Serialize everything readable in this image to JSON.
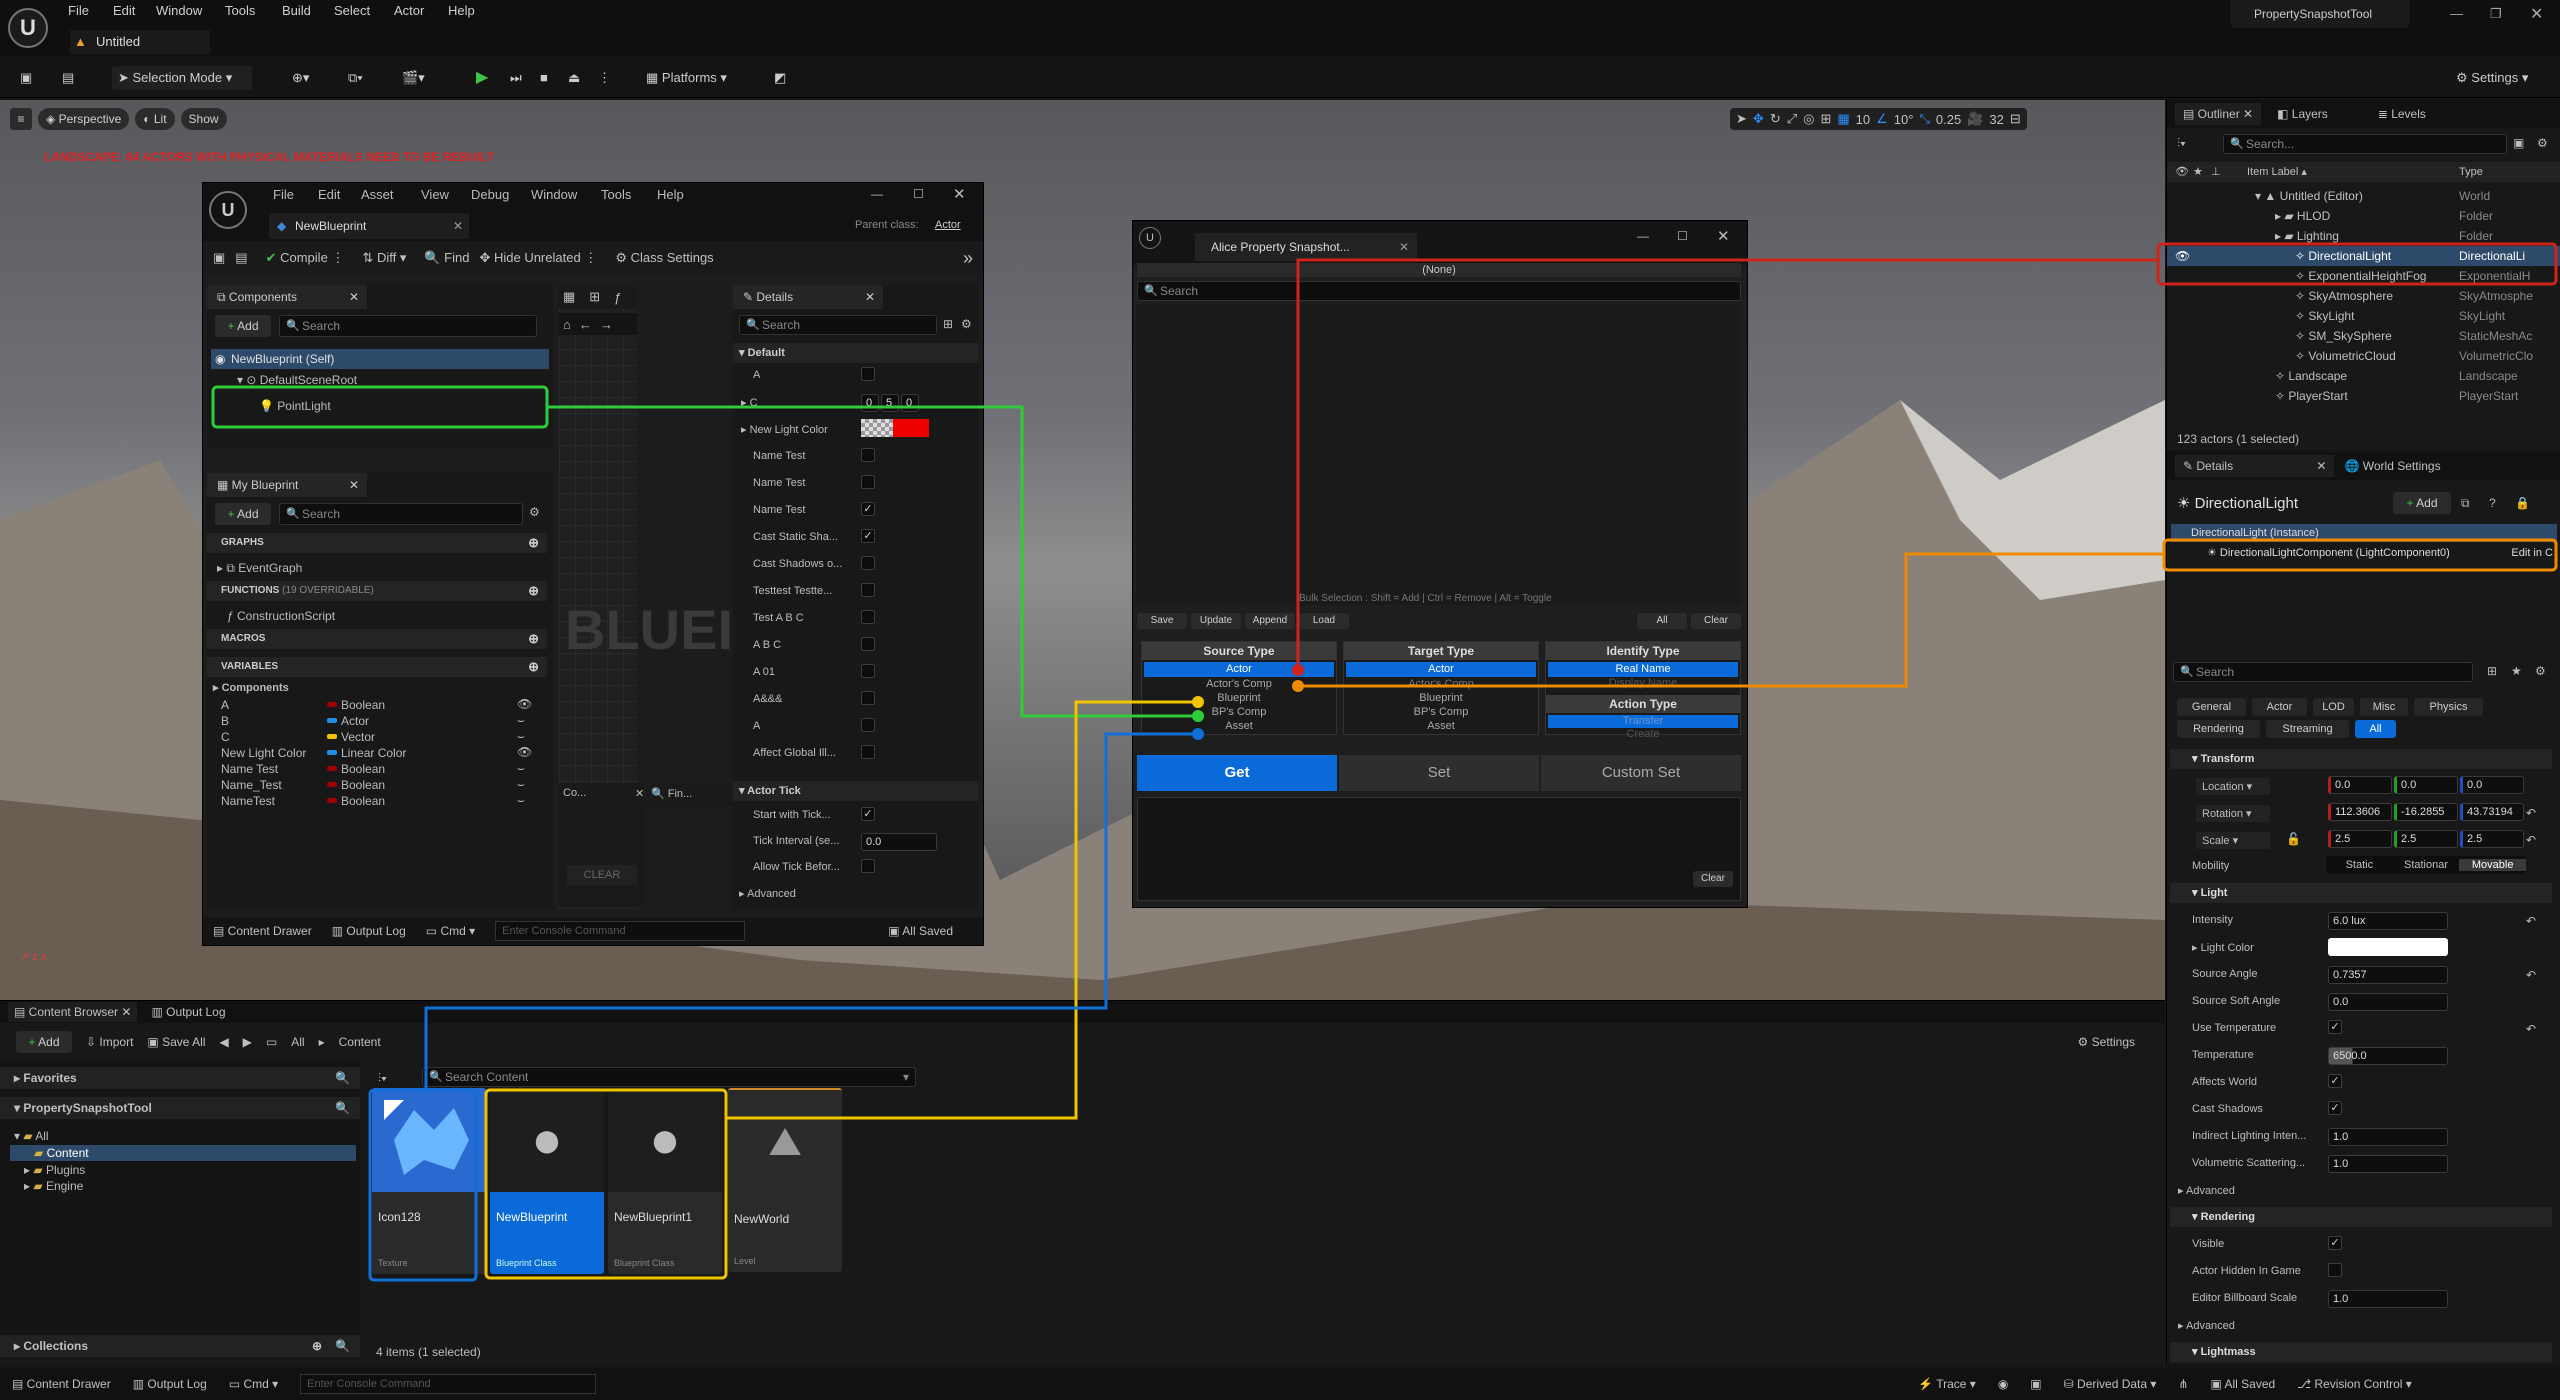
{
  "menubar": {
    "items": [
      "File",
      "Edit",
      "Window",
      "Tools",
      "Build",
      "Select",
      "Actor",
      "Help"
    ],
    "project": "PropertySnapshotTool",
    "tab": "Untitled"
  },
  "toolbar": {
    "selection_mode": "Selection Mode",
    "platforms": "Platforms",
    "settings": "Settings"
  },
  "viewport": {
    "perspective": "Perspective",
    "lit": "Lit",
    "show": "Show",
    "warning": "LANDSCAPE: 64 ACTORS WITH PHYSICAL MATERIALS NEED TO BE REBUILT",
    "grid_snap": "10",
    "rot_snap": "10°",
    "scale_snap": "0.25",
    "cam_speed": "32"
  },
  "bp_editor": {
    "menu": [
      "File",
      "Edit",
      "Asset",
      "View",
      "Debug",
      "Window",
      "Tools",
      "Help"
    ],
    "tab": "NewBlueprint",
    "parent_class_label": "Parent class:",
    "parent_class": "Actor",
    "toolbar": {
      "compile": "Compile",
      "diff": "Diff",
      "find": "Find",
      "hide_unrelated": "Hide Unrelated",
      "class_settings": "Class Settings"
    },
    "components": {
      "title": "Components",
      "add": "Add",
      "search": "Search",
      "self": "NewBlueprint (Self)",
      "root": "DefaultSceneRoot",
      "point_light": "PointLight"
    },
    "my_blueprint": {
      "title": "My Blueprint",
      "add": "Add",
      "search": "Search",
      "graphs": "GRAPHS",
      "event_graph": "EventGraph",
      "functions": "FUNCTIONS",
      "overridable": "(19 OVERRIDABLE)",
      "construction": "ConstructionScript",
      "macros": "MACROS",
      "variables": "VARIABLES",
      "components_cat": "Components",
      "vars": [
        {
          "name": "A",
          "type": "Boolean",
          "color": "#a00000"
        },
        {
          "name": "B",
          "type": "Actor",
          "color": "#1d8fe8"
        },
        {
          "name": "C",
          "type": "Vector",
          "color": "#f5c400"
        },
        {
          "name": "New Light Color",
          "type": "Linear Color",
          "color": "#1d8fe8"
        },
        {
          "name": "Name Test",
          "type": "Boolean",
          "color": "#a00000"
        },
        {
          "name": "Name_Test",
          "type": "Boolean",
          "color": "#a00000"
        },
        {
          "name": "NameTest",
          "type": "Boolean",
          "color": "#a00000"
        }
      ]
    },
    "graph": {
      "watermark": "BLUEI",
      "clear": "CLEAR",
      "compiler_tab": "Co...",
      "find_tab": "Fin..."
    },
    "details": {
      "title": "Details",
      "search": "Search",
      "default_cat": "Default",
      "rows": [
        "A",
        "C",
        "New Light Color",
        "Name Test",
        "Name Test",
        "Name Test",
        "Cast Static Sha...",
        "Cast Shadows o...",
        "Testtest Testte...",
        "Test A B  C",
        "A B C",
        "A 01",
        "A&&&",
        "A",
        "Affect Global Ill..."
      ],
      "c_values": [
        "0",
        "5",
        "0"
      ],
      "actor_tick": "Actor Tick",
      "start_with_tick": "Start with Tick...",
      "tick_interval": "Tick Interval (se...",
      "tick_value": "0.0",
      "allow_tick": "Allow Tick Befor...",
      "advanced": "Advanced"
    },
    "bottom": {
      "content_drawer": "Content Drawer",
      "output_log": "Output Log",
      "cmd": "Cmd",
      "console": "Enter Console Command",
      "saved": "All Saved"
    }
  },
  "snapshot": {
    "title": "Alice Property Snapshot...",
    "none": "(None)",
    "search": "Search",
    "buttons": [
      "Save",
      "Update",
      "Append",
      "Load"
    ],
    "all": "All",
    "clear": "Clear",
    "bulk_hint": "Bulk Selection : Shift = Add | Ctrl = Remove | Alt = Toggle",
    "source": {
      "header": "Source Type",
      "items": [
        "Actor",
        "Actor's Comp",
        "Blueprint",
        "BP's Comp",
        "Asset"
      ]
    },
    "target": {
      "header": "Target Type",
      "items": [
        "Actor",
        "Actor's Comp",
        "Blueprint",
        "BP's Comp",
        "Asset"
      ]
    },
    "identify": {
      "header": "Identify Type",
      "items": [
        "Real Name",
        "Display Name"
      ]
    },
    "action": {
      "header": "Action Type",
      "items": [
        "Transfer",
        "Create"
      ]
    },
    "get": "Get",
    "set": "Set",
    "custom_set": "Custom Set",
    "log_clear": "Clear"
  },
  "outliner": {
    "tabs": [
      "Outliner",
      "Layers",
      "Levels"
    ],
    "search": "Search...",
    "col_label": "Item Label",
    "col_type": "Type",
    "rows": [
      {
        "label": "Untitled (Editor)",
        "type": "World",
        "indent": 0
      },
      {
        "label": "HLOD",
        "type": "Folder",
        "indent": 1
      },
      {
        "label": "Lighting",
        "type": "Folder",
        "indent": 1
      },
      {
        "label": "DirectionalLight",
        "type": "DirectionalLi",
        "indent": 2
      },
      {
        "label": "ExponentialHeightFog",
        "type": "ExponentialH",
        "indent": 2
      },
      {
        "label": "SkyAtmosphere",
        "type": "SkyAtmosphe",
        "indent": 2
      },
      {
        "label": "SkyLight",
        "type": "SkyLight",
        "indent": 2
      },
      {
        "label": "SM_SkySphere",
        "type": "StaticMeshAc",
        "indent": 2
      },
      {
        "label": "VolumetricCloud",
        "type": "VolumetricClo",
        "indent": 2
      },
      {
        "label": "Landscape",
        "type": "Landscape",
        "indent": 1
      },
      {
        "label": "PlayerStart",
        "type": "PlayerStart",
        "indent": 1
      }
    ],
    "count": "123 actors (1 selected)"
  },
  "details": {
    "tabs": [
      "Details",
      "World Settings"
    ],
    "actor": "DirectionalLight",
    "add": "Add",
    "instance": "DirectionalLight (Instance)",
    "component": "DirectionalLightComponent (LightComponent0)",
    "edit": "Edit in C",
    "search": "Search",
    "filters": [
      "General",
      "Actor",
      "LOD",
      "Misc",
      "Physics",
      "Rendering",
      "Streaming",
      "All"
    ],
    "transform": "Transform",
    "location": "Location",
    "loc": [
      "0.0",
      "0.0",
      "0.0"
    ],
    "rotation": "Rotation",
    "rot": [
      "112.3606",
      "-16.2855",
      "43.73194"
    ],
    "scale": "Scale",
    "scl": [
      "2.5",
      "2.5",
      "2.5"
    ],
    "mobility": "Mobility",
    "mob": [
      "Static",
      "Stationar",
      "Movable"
    ],
    "light": "Light",
    "intensity": "Intensity",
    "intensity_v": "6.0 lux",
    "light_color": "Light Color",
    "source_angle": "Source Angle",
    "source_angle_v": "0.7357",
    "soft_angle": "Source Soft Angle",
    "soft_angle_v": "0.0",
    "use_temp": "Use Temperature",
    "temperature": "Temperature",
    "temperature_v": "6500.0",
    "affects_world": "Affects World",
    "cast_shadows": "Cast Shadows",
    "indirect": "Indirect Lighting Inten...",
    "indirect_v": "1.0",
    "volumetric": "Volumetric Scattering...",
    "volumetric_v": "1.0",
    "advanced": "Advanced",
    "rendering": "Rendering",
    "visible": "Visible",
    "hidden": "Actor Hidden In Game",
    "billboard": "Editor Billboard Scale",
    "billboard_v": "1.0",
    "advanced2": "Advanced",
    "lightmass": "Lightmass"
  },
  "content_browser": {
    "tabs": [
      "Content Browser",
      "Output Log"
    ],
    "add": "Add",
    "import": "Import",
    "save_all": "Save All",
    "path": [
      "All",
      "Content"
    ],
    "settings": "Settings",
    "favorites": "Favorites",
    "project": "PropertySnapshotTool",
    "tree": [
      "All",
      "Content",
      "Plugins",
      "Engine"
    ],
    "collections": "Collections",
    "search": "Search Content",
    "assets": [
      {
        "name": "Icon128",
        "type": "Texture"
      },
      {
        "name": "NewBlueprint",
        "type": "Blueprint Class"
      },
      {
        "name": "NewBlueprint1",
        "type": "Blueprint Class"
      },
      {
        "name": "NewWorld",
        "type": "Level"
      }
    ],
    "count": "4 items (1 selected)"
  },
  "statusbar": {
    "content_drawer": "Content Drawer",
    "output_log": "Output Log",
    "cmd": "Cmd",
    "console": "Enter Console Command",
    "trace": "Trace",
    "derived": "Derived Data",
    "saved": "All Saved",
    "revision": "Revision Control"
  },
  "colors": {
    "accent": "#0a6ad8",
    "annot_red": "#d0231c",
    "annot_green": "#2ecc3a",
    "annot_orange": "#f08a00",
    "annot_yellow": "#f0c400",
    "annot_blue": "#1070d8"
  }
}
